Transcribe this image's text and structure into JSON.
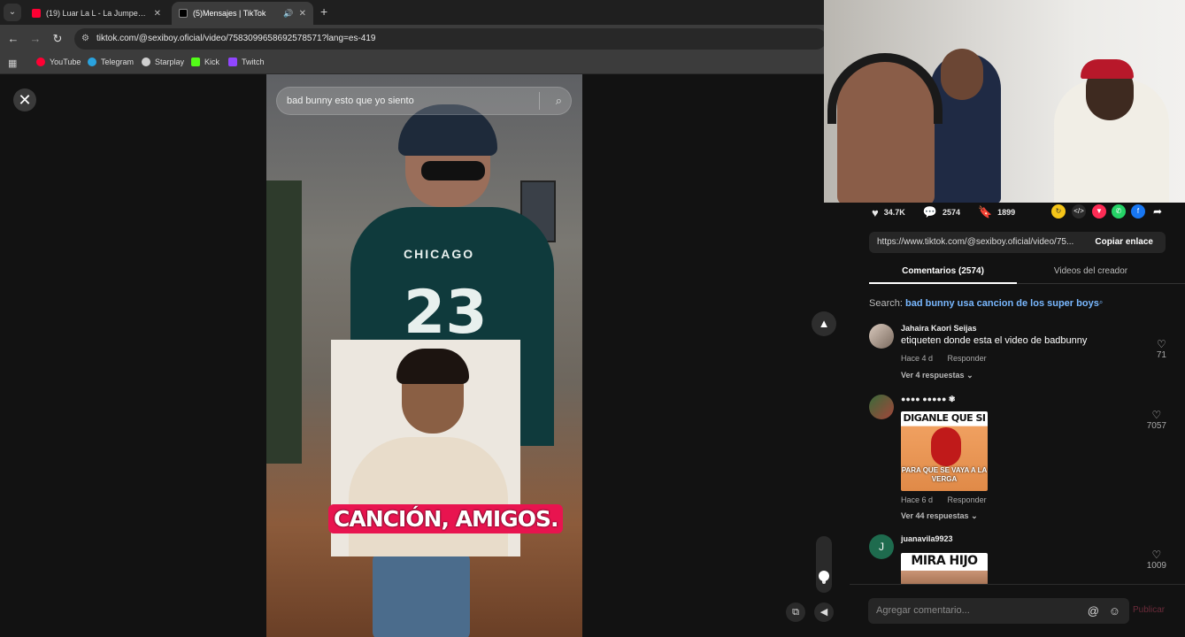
{
  "browser": {
    "tabs": [
      {
        "title": "(19) Luar La L - La Jumper (Visu",
        "favicon_color": "#ff0033"
      },
      {
        "title": "(5)Mensajes | TikTok",
        "favicon_color": "#000000"
      }
    ],
    "url": "tiktok.com/@sexiboy.oficial/video/7583099658692578571?lang=es-419",
    "bookmarks": [
      {
        "label": "YouTube",
        "color": "#ff0033"
      },
      {
        "label": "Telegram",
        "color": "#2aa3df"
      },
      {
        "label": "Starplay",
        "color": "#d0d0d0"
      },
      {
        "label": "Kick",
        "color": "#53fc18"
      },
      {
        "label": "Twitch",
        "color": "#9146ff"
      }
    ]
  },
  "video": {
    "search_text": "bad bunny esto que yo siento",
    "shirt_text": "CHICAGO",
    "shirt_number": "23",
    "caption": "CANCIÓN, AMIGOS.",
    "volume_level": 0.2
  },
  "stats": {
    "likes": "34.7K",
    "comments": "2574",
    "saves": "1899"
  },
  "share": {
    "link": "https://www.tiktok.com/@sexiboy.oficial/video/75...",
    "copy_label": "Copiar enlace"
  },
  "panel_tabs": {
    "comments": "Comentarios (2574)",
    "creator_videos": "Videos del creador"
  },
  "search_suggestion": {
    "prefix": "Search:",
    "query": "bad bunny usa cancion de los super boys"
  },
  "comments": [
    {
      "user": "Jahaira Kaori Seijas",
      "text": "etiqueten donde esta el video de badbunny",
      "time": "Hace 4 d",
      "reply": "Responder",
      "replies": "Ver 4 respuestas",
      "likes": "71"
    },
    {
      "user": "●●●● ●●●●● ✾",
      "meme_top": "DIGANLE QUE SI",
      "meme_bottom": "PARA QUE SE VAYA A LA VERGA",
      "time": "Hace 6 d",
      "reply": "Responder",
      "replies": "Ver 44 respuestas",
      "likes": "7057"
    },
    {
      "user": "juanavila9923",
      "avatar_letter": "J",
      "meme_top": "MIRA HIJO",
      "likes": "1009"
    }
  ],
  "comment_box": {
    "placeholder": "Agregar comentario...",
    "publish": "Publicar"
  }
}
